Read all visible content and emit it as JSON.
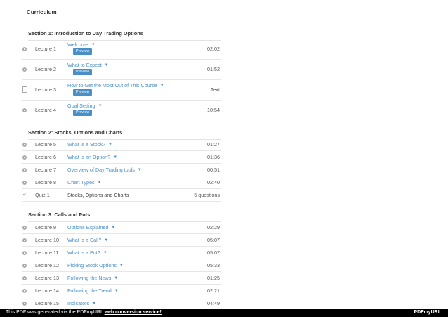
{
  "curriculum": {
    "title": "Curriculum"
  },
  "sections": [
    {
      "title": "Section 1: Introduction to Day Trading Options"
    },
    {
      "title": "Section 2: Stocks, Options and Charts"
    },
    {
      "title": "Section 3: Calls and Puts"
    }
  ],
  "preview_label": "Preview",
  "rows": [
    {
      "icon": "play-circle-icon",
      "label": "Lecture 1",
      "title": "Welcome",
      "duration": "02:02",
      "preview": true
    },
    {
      "icon": "play-circle-icon",
      "label": "Lecture 2",
      "title": "What to Expect",
      "duration": "01:52",
      "preview": true
    },
    {
      "icon": "file-icon",
      "label": "Lecture 3",
      "title": "How to Get the Most Out of This Course",
      "duration": "Text",
      "preview": true
    },
    {
      "icon": "play-circle-icon",
      "label": "Lecture 4",
      "title": "Goal Setting",
      "duration": "10:54",
      "preview": true
    },
    {
      "icon": "play-circle-icon",
      "label": "Lecture 5",
      "title": "What is a Stock?",
      "duration": "01:27"
    },
    {
      "icon": "play-circle-icon",
      "label": "Lecture 6",
      "title": "What is an Option?",
      "duration": "01:36"
    },
    {
      "icon": "play-circle-icon",
      "label": "Lecture 7",
      "title": "Overview of Day Trading tools",
      "duration": "00:51"
    },
    {
      "icon": "play-circle-icon",
      "label": "Lecture 8",
      "title": "Chart Types",
      "duration": "02:40"
    },
    {
      "icon": "check-icon",
      "label": "Quiz 1",
      "title": "Stocks, Options and Charts",
      "duration": "5 questions"
    },
    {
      "icon": "play-circle-icon",
      "label": "Lecture 9",
      "title": "Options Explained",
      "duration": "02:29"
    },
    {
      "icon": "play-circle-icon",
      "label": "Lecture 10",
      "title": "What is a Call?",
      "duration": "05:07"
    },
    {
      "icon": "play-circle-icon",
      "label": "Lecture 11",
      "title": "What is a Put?",
      "duration": "05:07"
    },
    {
      "icon": "play-circle-icon",
      "label": "Lecture 12",
      "title": "Picking Stock Options",
      "duration": "05:33"
    },
    {
      "icon": "play-circle-icon",
      "label": "Lecture 13",
      "title": "Following the News",
      "duration": "01:25"
    },
    {
      "icon": "play-circle-icon",
      "label": "Lecture 14",
      "title": "Following the Trend",
      "duration": "02:21"
    },
    {
      "icon": "play-circle-icon",
      "label": "Lecture 15",
      "title": "Indicators",
      "duration": "04:49"
    }
  ],
  "footer": {
    "text": "This PDF was generated via the PDFmyURL",
    "link": "web conversion service!",
    "brand": "PDFmyURL"
  },
  "colors": {
    "link": "#4a90c8",
    "preview_bg": "#4a90c8",
    "footer_bg": "#000000"
  }
}
